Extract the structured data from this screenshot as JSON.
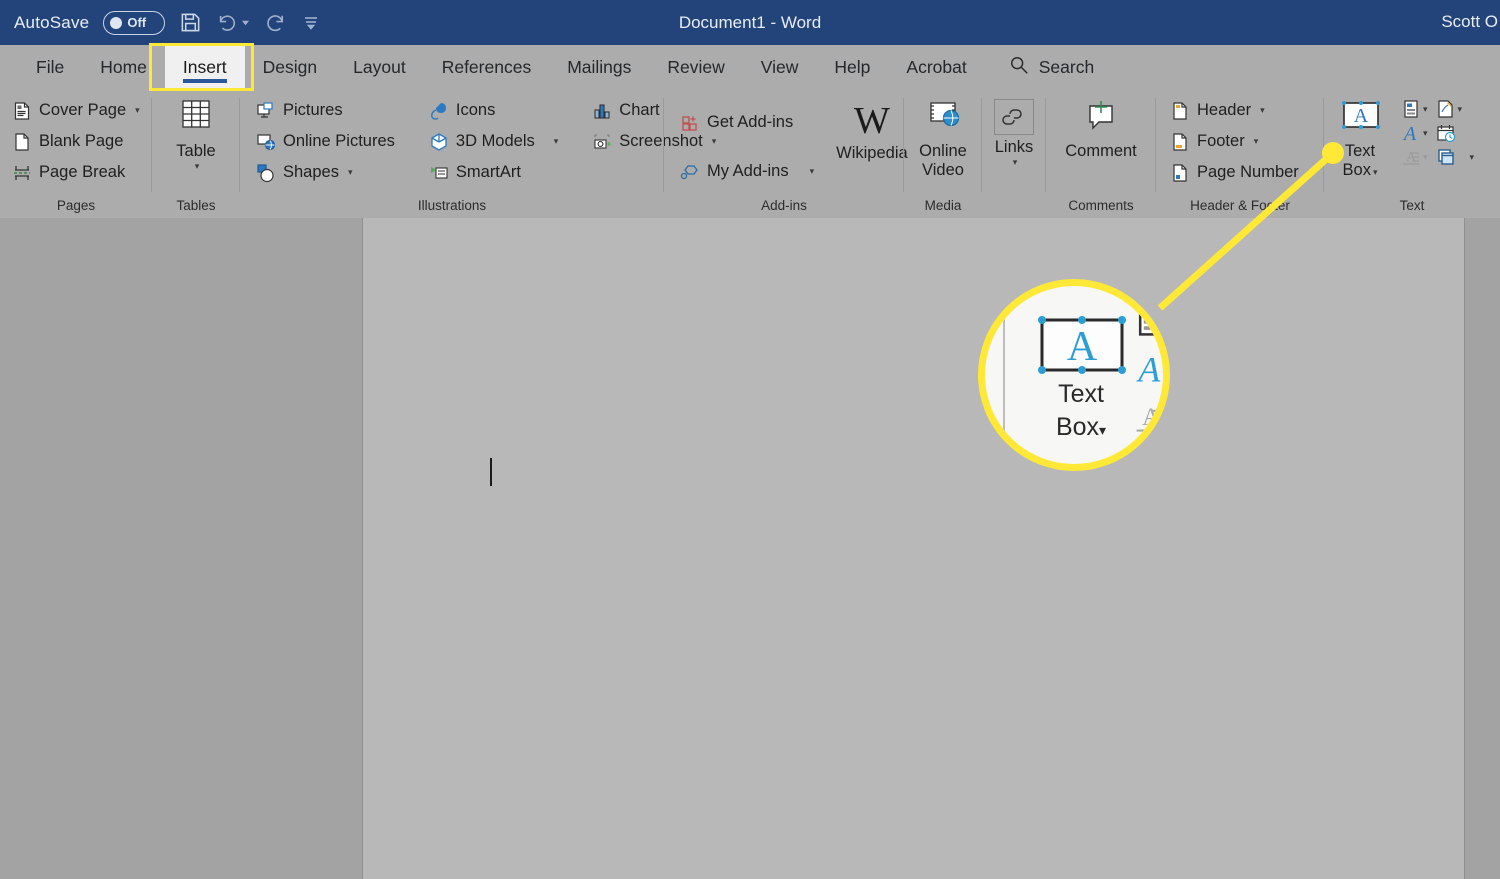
{
  "titlebar": {
    "autosave_label": "AutoSave",
    "autosave_state": "Off",
    "save_icon": "save-icon",
    "undo_icon": "undo-icon",
    "redo_icon": "redo-icon",
    "customize_icon": "customize-quick-access-toolbar-icon",
    "document_title": "Document1  -  Word",
    "account_name": "Scott O",
    "bg_color": "#23447a"
  },
  "tabs": [
    {
      "label": "File",
      "active": false
    },
    {
      "label": "Home",
      "active": false
    },
    {
      "label": "Insert",
      "active": true
    },
    {
      "label": "Design",
      "active": false
    },
    {
      "label": "Layout",
      "active": false
    },
    {
      "label": "References",
      "active": false
    },
    {
      "label": "Mailings",
      "active": false
    },
    {
      "label": "Review",
      "active": false
    },
    {
      "label": "View",
      "active": false
    },
    {
      "label": "Help",
      "active": false
    },
    {
      "label": "Acrobat",
      "active": false
    }
  ],
  "search": {
    "label": "Search",
    "icon": "search-icon"
  },
  "ribbon": {
    "groups": [
      {
        "label": "Pages",
        "items": [
          {
            "label": "Cover Page",
            "icon": "cover-page-icon",
            "dropdown": true
          },
          {
            "label": "Blank Page",
            "icon": "blank-page-icon",
            "dropdown": false
          },
          {
            "label": "Page Break",
            "icon": "page-break-icon",
            "dropdown": false
          }
        ]
      },
      {
        "label": "Tables",
        "items": [
          {
            "label": "Table",
            "icon": "table-icon",
            "dropdown": true
          }
        ]
      },
      {
        "label": "Illustrations",
        "items": [
          {
            "label": "Pictures",
            "icon": "pictures-icon",
            "dropdown": false
          },
          {
            "label": "Online Pictures",
            "icon": "online-pictures-icon",
            "dropdown": false
          },
          {
            "label": "Shapes",
            "icon": "shapes-icon",
            "dropdown": true
          },
          {
            "label": "Icons",
            "icon": "icons-icon",
            "dropdown": false
          },
          {
            "label": "3D Models",
            "icon": "3d-models-icon",
            "dropdown": true
          },
          {
            "label": "SmartArt",
            "icon": "smartart-icon",
            "dropdown": false
          },
          {
            "label": "Chart",
            "icon": "chart-icon",
            "dropdown": false
          },
          {
            "label": "Screenshot",
            "icon": "screenshot-icon",
            "dropdown": true
          }
        ]
      },
      {
        "label": "Add-ins",
        "items": [
          {
            "label": "Get Add-ins",
            "icon": "get-add-ins-icon",
            "dropdown": false
          },
          {
            "label": "My Add-ins",
            "icon": "my-add-ins-icon",
            "dropdown": true
          },
          {
            "label": "Wikipedia",
            "icon": "wikipedia-icon",
            "dropdown": false
          }
        ]
      },
      {
        "label": "Media",
        "items": [
          {
            "label": "Online\nVideo",
            "label_line1": "Online",
            "label_line2": "Video",
            "icon": "online-video-icon",
            "dropdown": false
          }
        ]
      },
      {
        "label": "Links",
        "items": [
          {
            "label": "Links",
            "icon": "links-icon",
            "dropdown": true
          }
        ]
      },
      {
        "label": "Comments",
        "items": [
          {
            "label": "Comment",
            "icon": "comment-icon",
            "dropdown": false
          }
        ]
      },
      {
        "label": "Header & Footer",
        "items": [
          {
            "label": "Header",
            "icon": "header-icon",
            "dropdown": true
          },
          {
            "label": "Footer",
            "icon": "footer-icon",
            "dropdown": true
          },
          {
            "label": "Page Number",
            "icon": "page-number-icon",
            "dropdown": true
          }
        ]
      },
      {
        "label": "Text",
        "items": [
          {
            "label": "Text Box",
            "label_line1": "Text",
            "label_line2": "Box",
            "icon": "text-box-icon",
            "dropdown": true
          },
          {
            "label": "Quick Parts",
            "icon": "quick-parts-icon",
            "dropdown": true
          },
          {
            "label": "WordArt",
            "icon": "wordart-icon",
            "dropdown": true
          },
          {
            "label": "Drop Cap",
            "icon": "drop-cap-icon",
            "dropdown": true
          },
          {
            "label": "Signature Line",
            "icon": "signature-line-icon",
            "dropdown": true
          },
          {
            "label": "Date & Time",
            "icon": "date-and-time-icon",
            "dropdown": false
          },
          {
            "label": "Object",
            "icon": "object-icon",
            "dropdown": true
          }
        ]
      }
    ]
  },
  "callout": {
    "highlight_color": "#ffe836",
    "highlighted_tab": "Insert",
    "magnified_button_line1": "Text",
    "magnified_button_line2": "Box",
    "pointer_icon": "yellow-dot-pointer"
  },
  "document": {
    "page_background": "#b8b8b8",
    "canvas_background": "#a3a3a3",
    "cursor": "text-cursor"
  }
}
